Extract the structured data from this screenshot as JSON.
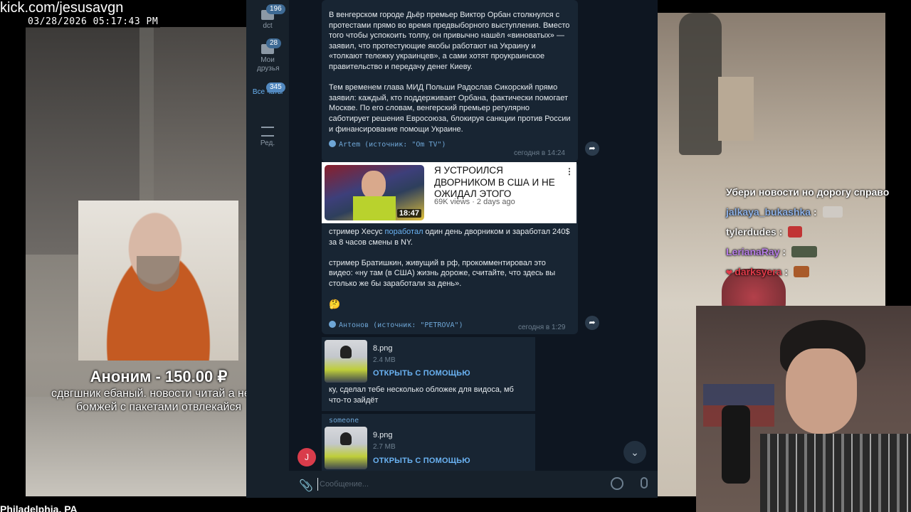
{
  "overlay": {
    "url": "kick.com/jesusavgn",
    "timestamp": "03/28/2026 05:17:43 PM",
    "location": "Philadelphia, PA"
  },
  "donation": {
    "title": "Аноним - 150.00 ₽",
    "message": "сдвгшник ебаный. новости читай а не на бомжей с пакетами отвлекайся"
  },
  "telegram": {
    "folders": [
      {
        "label": "dct",
        "badge": "196",
        "active": false
      },
      {
        "label": "Мои друзья",
        "badge": "28",
        "active": false
      },
      {
        "label": "Все чаты",
        "badge": "345",
        "active": true
      },
      {
        "label": "Ред.",
        "badge": "",
        "active": false
      }
    ],
    "message1": {
      "paragraphs": [
        "В венгерском городе Дьёр премьер Виктор Орбан столкнулся с протестами прямо во время предвыборного выступления. Вместо того чтобы успокоить толпу, он привычно нашёл «виноватых» — заявил, что протестующие якобы работают на Украину и «толкают тележку украинцев», а сами хотят проукраинское правительство и передачу денег Киеву.",
        "Тем временем глава МИД Польши Радослав Сикорский прямо заявил: каждый, кто поддерживает Орбана, фактически помогает Москве. По его словам, венгерский премьер регулярно саботирует решения Евросоюза, блокируя санкции против России и финансирование помощи Украине."
      ],
      "author": "Artem (источник: \"Om TV\")",
      "time": "сегодня в 14:24"
    },
    "video_card": {
      "title": "Я УСТРОИЛСЯ ДВОРНИКОМ В США И НЕ ОЖИДАЛ ЭТОГО",
      "meta": "69K views · 2 days ago",
      "duration": "18:47"
    },
    "message2": {
      "line1_before": "стример Хесус ",
      "line1_link": "поработал",
      "line1_after": " один день дворником и заработал 240$ за 8 часов смены в NY.",
      "paragraph2": "стример Братишкин, живущий в рф, прокомментировал это видео: «ну там (в США) жизнь дороже, считайте, что здесь вы столько же бы заработали за день».",
      "emoji": "🤔",
      "author": "Антонов (источник: \"PETROVA\")",
      "time": "сегодня в 1:29"
    },
    "file1": {
      "name": "8.png",
      "size": "2.4 MB",
      "open": "ОТКРЫТЬ С ПОМОЩЬЮ",
      "caption": "ку, сделал тебе несколько обложек для видоса, мб что-то зайдёт"
    },
    "file2": {
      "sender": "someone",
      "name": "9.png",
      "size": "2.7 MB",
      "open": "ОТКРЫТЬ С ПОМОЩЬЮ"
    },
    "avatar_letter": "J",
    "composer_placeholder": "Сообщение..."
  },
  "chat": {
    "header": "Убери новости но дорогу справо",
    "messages": [
      {
        "user": "jalkaya_bukashka",
        "color": "#8fb3e8"
      },
      {
        "user": "tylerdudes",
        "color": "#f2f2f2"
      },
      {
        "user": "LerianaRay",
        "color": "#b87ee8"
      },
      {
        "user": "darksyera",
        "color": "#e23b4a"
      }
    ]
  }
}
